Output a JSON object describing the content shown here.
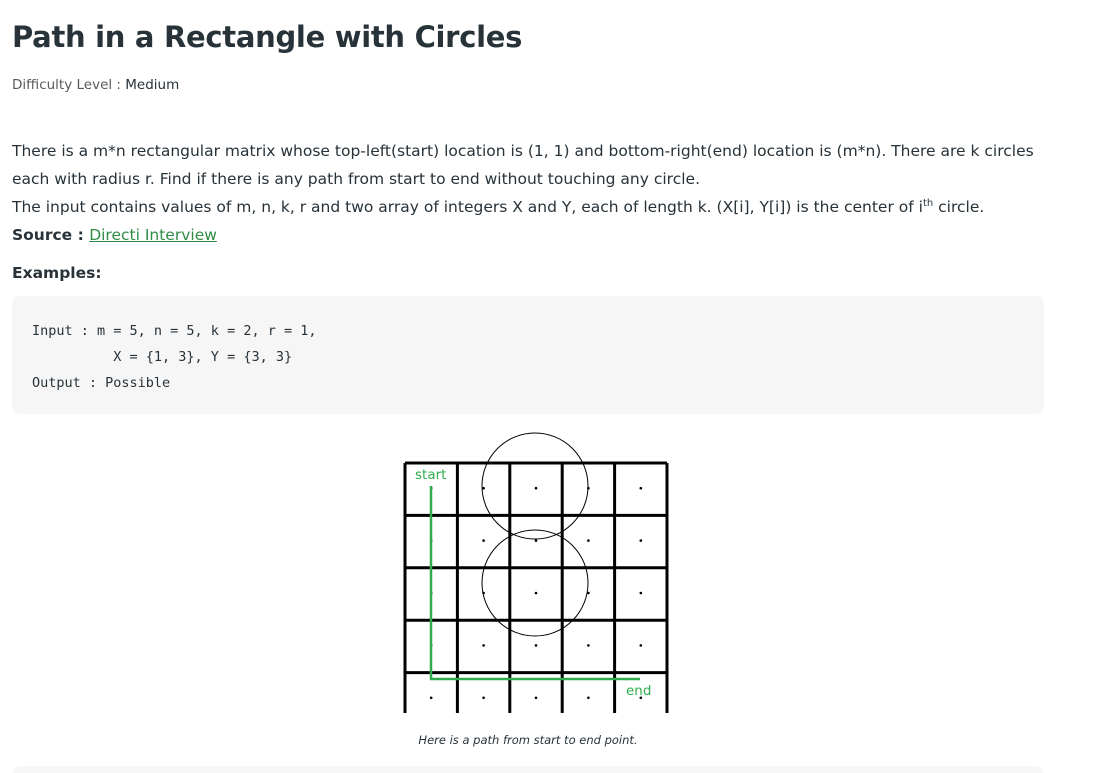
{
  "article": {
    "title": "Path in a Rectangle with Circles",
    "difficulty_label": "Difficulty Level : ",
    "difficulty_value": "Medium",
    "paragraph1": "There is a m*n rectangular matrix whose top-left(start) location is (1, 1) and bottom-right(end) location is (m*n). There are k circles each with radius r. Find if there is any path from start to end without touching any circle.",
    "paragraph2_pre": "The input contains values of m, n, k, r and two array of integers X and Y, each of length k. (X[i], Y[i]) is the center of i",
    "paragraph2_sup": "th",
    "paragraph2_post": " circle.",
    "source_label": "Source : ",
    "source_link": "Directi Interview",
    "examples_heading": "Examples:",
    "code_lines": [
      "Input : m = 5, n = 5, k = 2, r = 1,",
      "          X = {1, 3}, Y = {3, 3}",
      "Output : Possible"
    ],
    "figure": {
      "start_label": "start",
      "end_label": "end",
      "path_color": "#2fad4e"
    },
    "caption": "Here is a path from start to end point."
  }
}
